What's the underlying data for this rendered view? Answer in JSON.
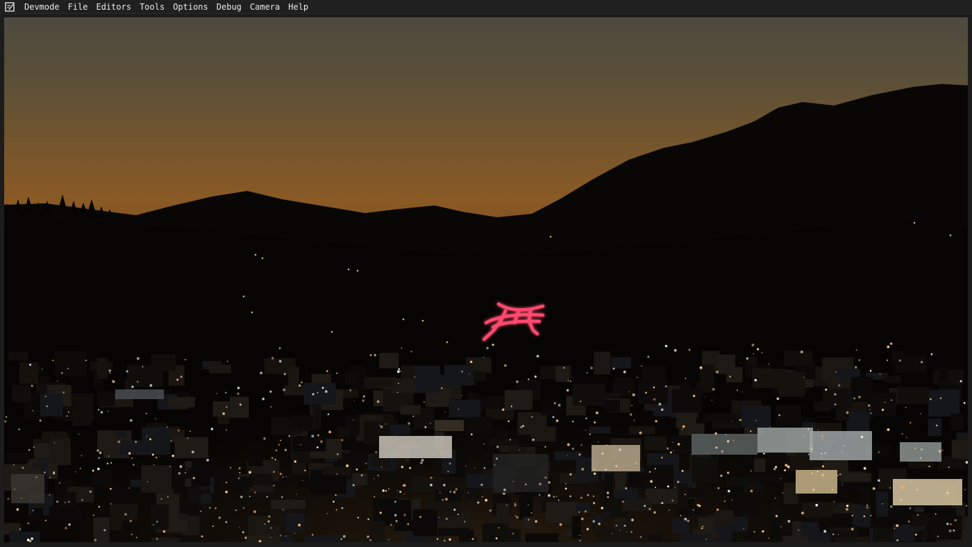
{
  "menubar": {
    "app_icon": "editor-icon",
    "items": [
      "Devmode",
      "File",
      "Editors",
      "Tools",
      "Options",
      "Debug",
      "Camera",
      "Help"
    ]
  },
  "viewport": {
    "scene": "night-city-valley-with-neon-sign",
    "colors": {
      "sky_top": "#4e4a40",
      "sky_horizon": "#8a5a25",
      "mountains": "#070605",
      "neon_sign": "#ff4a6e",
      "window_light": "#ffd8a0"
    }
  }
}
